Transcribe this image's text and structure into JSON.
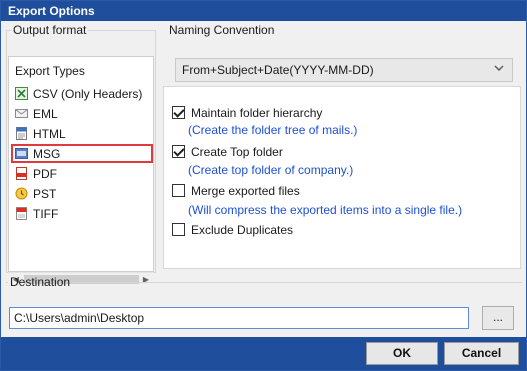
{
  "window": {
    "title": "Export Options"
  },
  "output_format": {
    "legend": "Output format",
    "header": "Export Types",
    "items": [
      {
        "label": "CSV (Only Headers)",
        "icon": "csv-icon"
      },
      {
        "label": "EML",
        "icon": "eml-icon"
      },
      {
        "label": "HTML",
        "icon": "html-icon"
      },
      {
        "label": "MSG",
        "icon": "msg-icon",
        "selected": true
      },
      {
        "label": "PDF",
        "icon": "pdf-icon"
      },
      {
        "label": "PST",
        "icon": "pst-icon"
      },
      {
        "label": "TIFF",
        "icon": "tiff-icon"
      }
    ]
  },
  "naming": {
    "legend": "Naming Convention",
    "selected": "From+Subject+Date(YYYY-MM-DD)"
  },
  "options": [
    {
      "label": "Maintain folder hierarchy",
      "checked": true,
      "note": "(Create the folder tree of mails.)"
    },
    {
      "label": "Create Top folder",
      "checked": true,
      "note": "(Create top folder of company.)"
    },
    {
      "label": "Merge exported files",
      "checked": false,
      "note": "(Will compress the exported items into a single file.)"
    },
    {
      "label": "Exclude Duplicates",
      "checked": false,
      "note": ""
    }
  ],
  "destination": {
    "legend": "Destination",
    "path": "C:\\Users\\admin\\Desktop",
    "browse_label": "..."
  },
  "buttons": {
    "ok": "OK",
    "cancel": "Cancel"
  },
  "colors": {
    "title_bar": "#1f4f9c",
    "note_text": "#1e50d6",
    "selection_outline": "#e0393e"
  }
}
